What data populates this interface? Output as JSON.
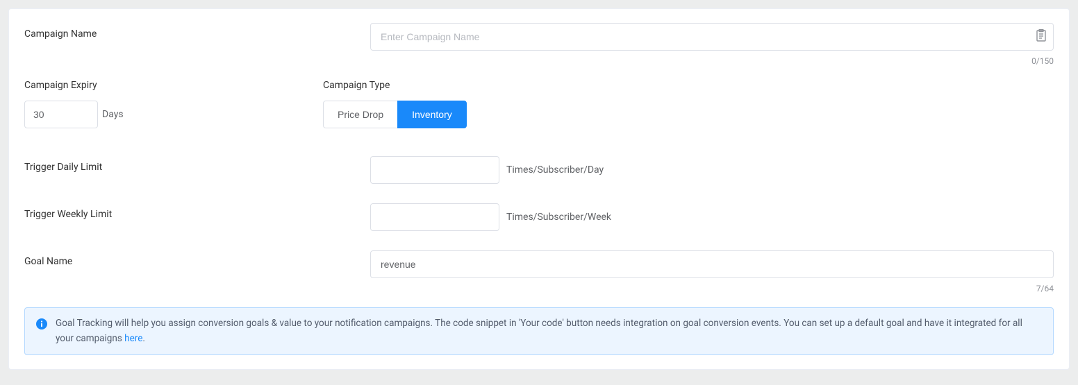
{
  "form": {
    "campaign_name": {
      "label": "Campaign Name",
      "placeholder": "Enter Campaign Name",
      "value": "",
      "counter": "0/150"
    },
    "expiry": {
      "label": "Campaign Expiry",
      "value": "30",
      "unit": "Days"
    },
    "type": {
      "label": "Campaign Type",
      "options": {
        "price_drop": "Price Drop",
        "inventory": "Inventory"
      },
      "selected": "inventory"
    },
    "daily_limit": {
      "label": "Trigger Daily Limit",
      "value": "",
      "suffix": "Times/Subscriber/Day"
    },
    "weekly_limit": {
      "label": "Trigger Weekly Limit",
      "value": "",
      "suffix": "Times/Subscriber/Week"
    },
    "goal_name": {
      "label": "Goal Name",
      "value": "revenue",
      "counter": "7/64"
    }
  },
  "alert": {
    "text_before": "Goal Tracking will help you assign conversion goals & value to your notification campaigns. The code snippet in 'Your code' button needs integration on goal conversion events. You can set up a default goal and have it integrated for all your campaigns ",
    "link_text": "here",
    "text_after": "."
  }
}
